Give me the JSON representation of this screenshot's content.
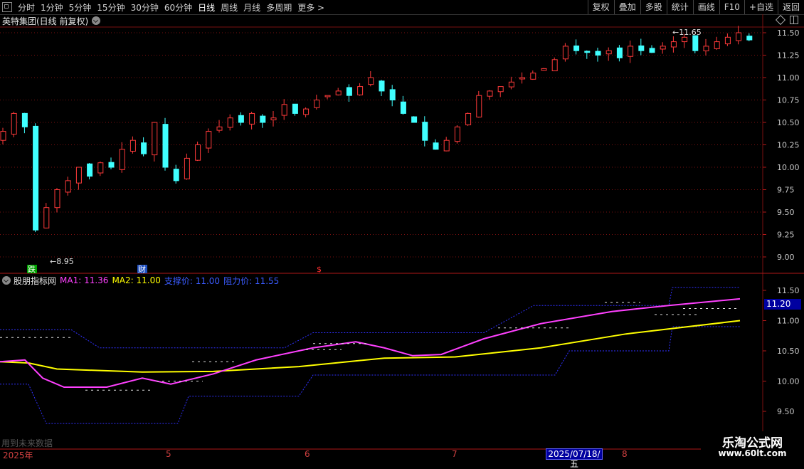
{
  "toolbar": {
    "periods": [
      "分时",
      "1分钟",
      "5分钟",
      "15分钟",
      "30分钟",
      "60分钟",
      "日线",
      "周线",
      "月线",
      "多周期",
      "更多 >"
    ],
    "active_period": "日线",
    "buttons": [
      "复权",
      "叠加",
      "多股",
      "统计",
      "画线",
      "F10",
      "+自选",
      "返回"
    ]
  },
  "main_chart": {
    "title": "英特集团(日线 前复权)",
    "price_ticks": [
      "11.50",
      "11.25",
      "11.00",
      "10.75",
      "10.50",
      "10.25",
      "10.00",
      "9.75",
      "9.50",
      "9.25",
      "9.00"
    ],
    "low_label": "8.95",
    "high_label": "11.65",
    "markers": [
      {
        "text": "跌",
        "color": "#ffffff",
        "bg": "#00a000"
      },
      {
        "text": "财",
        "color": "#ffffff",
        "bg": "#2050c0"
      },
      {
        "text": "$",
        "color": "#ff3030",
        "bg": ""
      }
    ],
    "colors": {
      "up": "#ff3a3a",
      "down": "#40ffff",
      "grid": "#7a1010"
    }
  },
  "indicator": {
    "title": "股朋指标网",
    "ma1_label": "MA1: 11.36",
    "ma2_label": "MA2: 11.00",
    "support_label": "支撑价: 11.00",
    "resist_label": "阻力价: 11.55",
    "ticks": [
      "11.50",
      "11.00",
      "10.50",
      "10.00",
      "9.50"
    ],
    "current_price": "11.20",
    "note": "用到未来数据",
    "colors": {
      "ma1": "#ff40ff",
      "ma1_dip": "#40ff40",
      "ma2": "#ffff00",
      "ma2_dip": "#40ffff",
      "band": "#3030ff",
      "dash": "#e0e0e0"
    }
  },
  "axis": {
    "dates": [
      "2025年",
      "5",
      "6",
      "7",
      "8"
    ],
    "selected_date": "2025/07/18/五"
  },
  "watermark": {
    "main": "乐淘公式网",
    "url": "www.60lt.com"
  }
}
